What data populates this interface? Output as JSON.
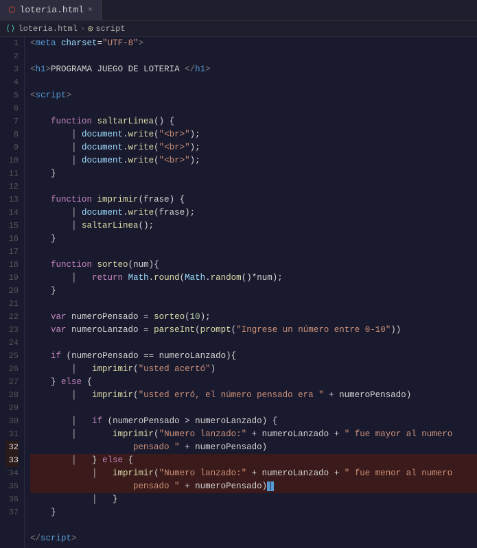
{
  "tab": {
    "filename": "loteria.html",
    "close_label": "×"
  },
  "breadcrumb": {
    "file": "loteria.html",
    "section": "script",
    "separator": "›"
  },
  "lines": [
    {
      "num": 1,
      "content": "META_CHARSET"
    },
    {
      "num": 2,
      "content": "EMPTY"
    },
    {
      "num": 3,
      "content": "H1_PROG"
    },
    {
      "num": 4,
      "content": "EMPTY"
    },
    {
      "num": 5,
      "content": "SCRIPT_OPEN"
    },
    {
      "num": 6,
      "content": "EMPTY"
    },
    {
      "num": 7,
      "content": "FN_SALTAR_DEF"
    },
    {
      "num": 8,
      "content": "DOC_WRITE_BR1"
    },
    {
      "num": 9,
      "content": "DOC_WRITE_BR2"
    },
    {
      "num": 10,
      "content": "DOC_WRITE_BR3"
    },
    {
      "num": 11,
      "content": "CLOSE_BRACE1"
    },
    {
      "num": 12,
      "content": "EMPTY"
    },
    {
      "num": 13,
      "content": "FN_IMPRIMIR_DEF"
    },
    {
      "num": 14,
      "content": "DOC_WRITE_FRASE"
    },
    {
      "num": 15,
      "content": "SALTAR_LINEA"
    },
    {
      "num": 16,
      "content": "CLOSE_BRACE2"
    },
    {
      "num": 17,
      "content": "EMPTY"
    },
    {
      "num": 18,
      "content": "FN_SORTEO_DEF"
    },
    {
      "num": 19,
      "content": "RETURN_MATH"
    },
    {
      "num": 20,
      "content": "CLOSE_BRACE3"
    },
    {
      "num": 21,
      "content": "EMPTY"
    },
    {
      "num": 22,
      "content": "VAR_PENSADO"
    },
    {
      "num": 23,
      "content": "VAR_LANZADO"
    },
    {
      "num": 24,
      "content": "EMPTY"
    },
    {
      "num": 25,
      "content": "IF_PENSADO"
    },
    {
      "num": 26,
      "content": "IMPRIMIR_ACERTO"
    },
    {
      "num": 27,
      "content": "ELSE_OPEN"
    },
    {
      "num": 28,
      "content": "IMPRIMIR_ERRO"
    },
    {
      "num": 29,
      "content": "EMPTY"
    },
    {
      "num": 30,
      "content": "IF_PENSADO_GT"
    },
    {
      "num": 31,
      "content": "IMPRIMIR_MAYOR_LINE1"
    },
    {
      "num": 32,
      "content": "ELSE_OPEN2"
    },
    {
      "num": 33,
      "content": "IMPRIMIR_MENOR_LINE1",
      "highlighted": true
    },
    {
      "num": 34,
      "content": "CLOSE_BRACE_INNER"
    },
    {
      "num": 35,
      "content": "CLOSE_BRACE_OUTER"
    },
    {
      "num": 36,
      "content": "EMPTY"
    },
    {
      "num": 37,
      "content": "SCRIPT_CLOSE"
    }
  ]
}
